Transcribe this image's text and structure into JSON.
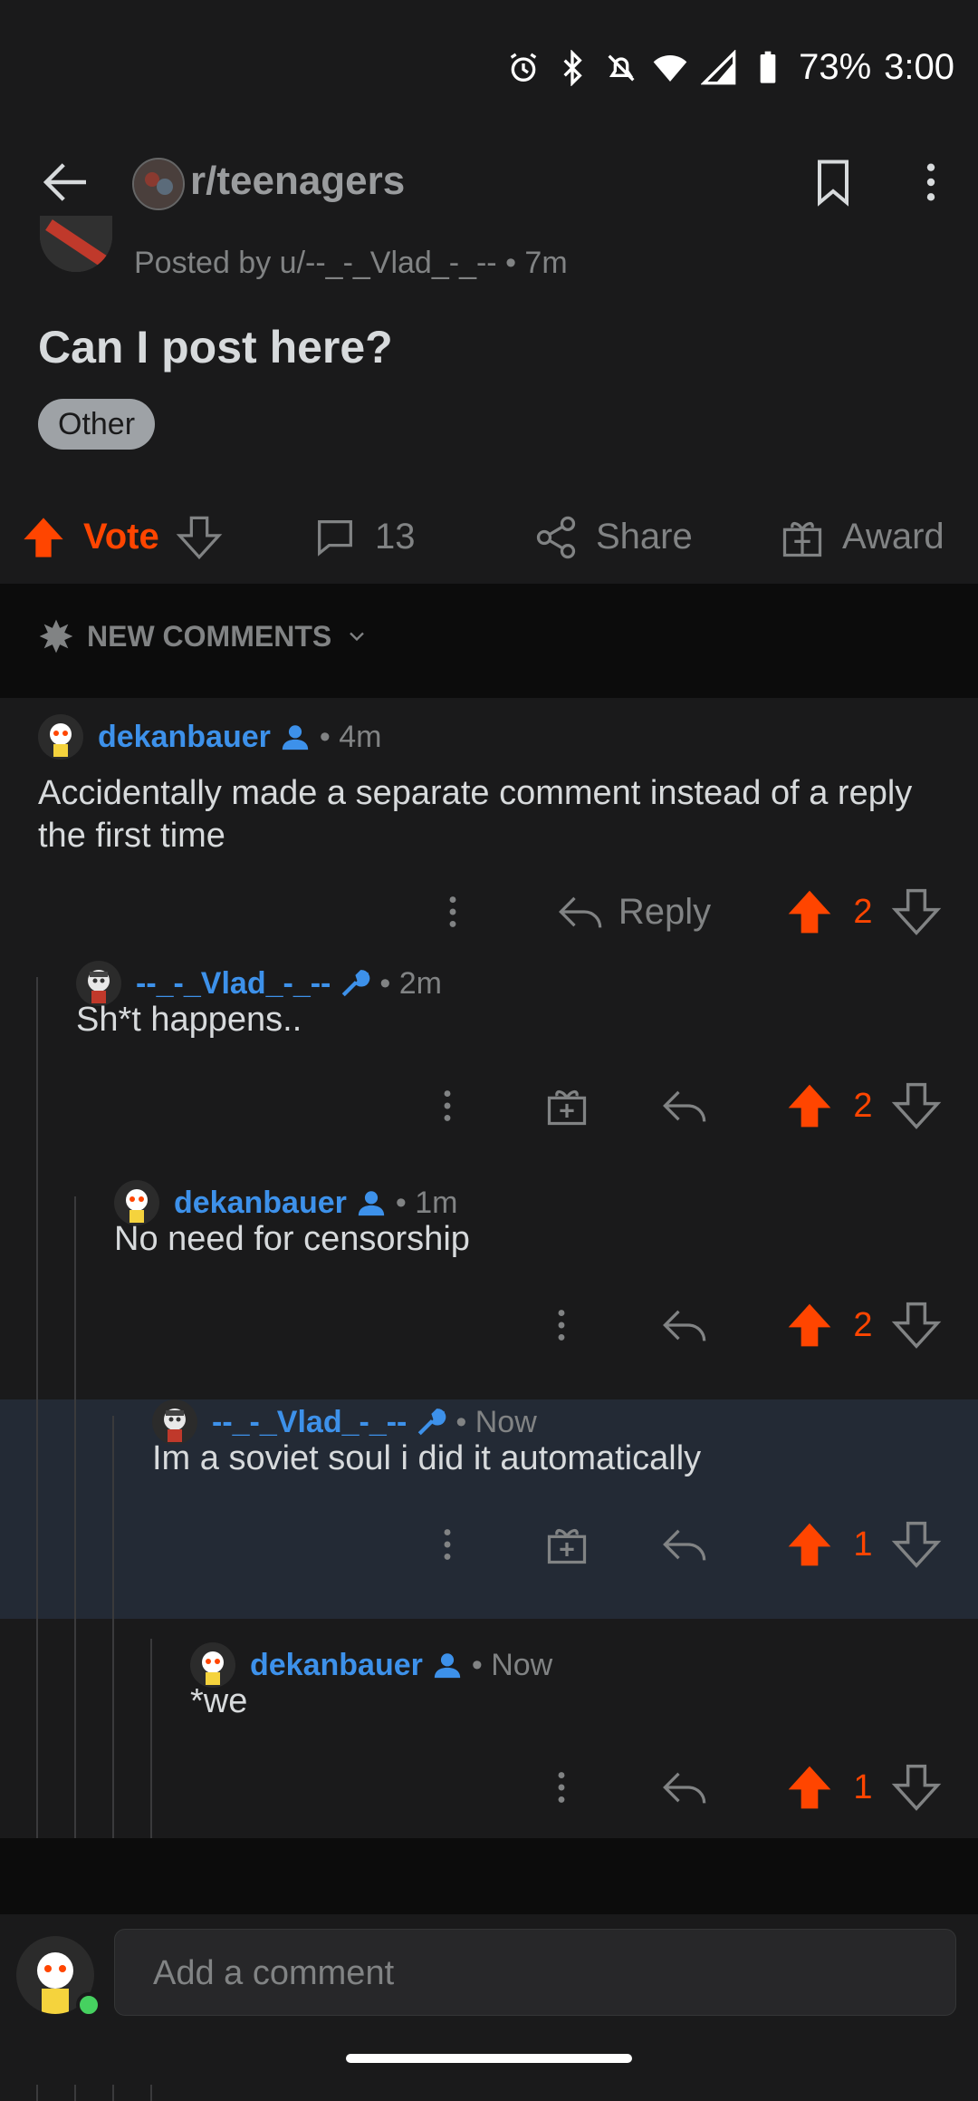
{
  "status_bar": {
    "battery": "73%",
    "time": "3:00"
  },
  "top_bar": {
    "subreddit": "r/teenagers"
  },
  "post": {
    "posted_by": "Posted by u/--_-_Vlad_-_-- • 7m",
    "title": "Can I post here?",
    "flair": "Other",
    "actions": {
      "vote_label": "Vote",
      "comment_count": "13",
      "share_label": "Share",
      "award_label": "Award"
    }
  },
  "sort_bar": {
    "label": "NEW COMMENTS"
  },
  "comments": [
    {
      "user": "dekanbauer",
      "time": "• 4m",
      "body": "Accidentally made a separate comment instead of a reply the first time",
      "votes": "2",
      "reply_label": "Reply"
    },
    {
      "user": "--_-_Vlad_-_--",
      "time": "• 2m",
      "body": "Sh*t happens..",
      "votes": "2"
    },
    {
      "user": "dekanbauer",
      "time": "• 1m",
      "body": "No need for censorship",
      "votes": "2"
    },
    {
      "user": "--_-_Vlad_-_--",
      "time": "• Now",
      "body": "Im a soviet soul i did it automatically",
      "votes": "1"
    },
    {
      "user": "dekanbauer",
      "time": "• Now",
      "body": "*we",
      "votes": "1"
    }
  ],
  "composer": {
    "placeholder": "Add a comment"
  },
  "colors": {
    "upvote": "#ff4500",
    "username": "#3d91ea",
    "background": "#1a1a1b",
    "highlight": "#232a35"
  },
  "icons": [
    "alarm-icon",
    "bluetooth-icon",
    "mute-icon",
    "wifi-icon",
    "signal-icon",
    "battery-icon",
    "back-arrow-icon",
    "bookmark-icon",
    "more-vertical-icon",
    "upvote-icon",
    "downvote-icon",
    "comment-icon",
    "share-icon",
    "award-icon",
    "reply-icon",
    "sparkle-icon",
    "chevron-down-icon",
    "user-icon",
    "mod-wrench-icon"
  ]
}
